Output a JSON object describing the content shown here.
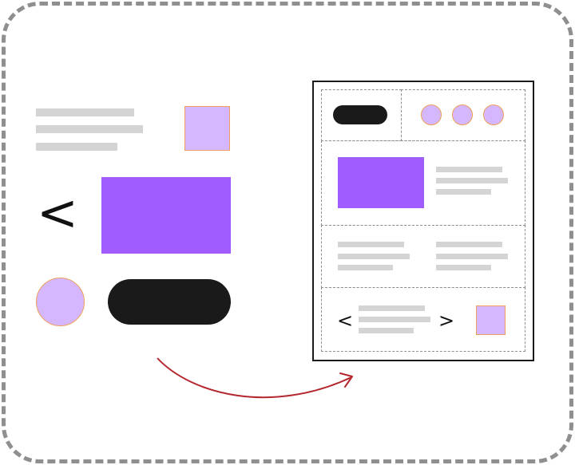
{
  "colors": {
    "frame": "#8f8f8f",
    "placeholder_line": "#d4d4d4",
    "lavender": "#d4b7ff",
    "violet": "#a05cff",
    "dark": "#1a1a1a",
    "outline_orange": "#f0a05a",
    "arrow": "#b3262e"
  },
  "left_components": {
    "chevron_glyph": "<"
  },
  "wireframe": {
    "prev_glyph": "<",
    "next_glyph": ">"
  },
  "icons": {
    "arrow": "curved-arrow-icon",
    "left_chevron": "chevron-left-icon",
    "right_chevron": "chevron-right-icon"
  }
}
